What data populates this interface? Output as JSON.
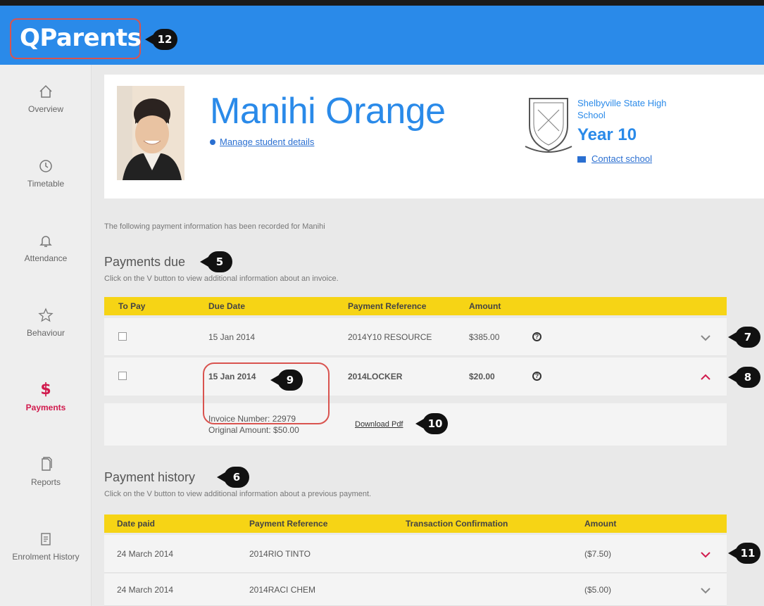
{
  "app": {
    "logo": "QParents"
  },
  "callouts": {
    "logo": "12",
    "payments_due": "5",
    "payment_history": "6",
    "row1_expand": "7",
    "row2_collapse": "8",
    "due_date": "9",
    "download_pdf": "10",
    "history_expand": "11"
  },
  "sidebar": {
    "items": [
      {
        "label": "Overview",
        "icon": "home-icon"
      },
      {
        "label": "Timetable",
        "icon": "clock-icon"
      },
      {
        "label": "Attendance",
        "icon": "bell-icon"
      },
      {
        "label": "Behaviour",
        "icon": "star-icon"
      },
      {
        "label": "Payments",
        "icon": "dollar-icon",
        "active": true
      },
      {
        "label": "Reports",
        "icon": "report-icon"
      },
      {
        "label": "Enrolment History",
        "icon": "document-icon"
      }
    ]
  },
  "profile": {
    "name": "Manihi Orange",
    "manage_link": "Manage student details",
    "school": "Shelbyville State High School",
    "year": "Year 10",
    "contact_link": "Contact school"
  },
  "intro": "The following payment information has been recorded for Manihi",
  "payments_due": {
    "title": "Payments due",
    "subtitle": "Click on the V button to view additional information about an invoice.",
    "columns": [
      "To Pay",
      "Due Date",
      "Payment Reference",
      "Amount"
    ],
    "rows": [
      {
        "due_date": "15 Jan 2014",
        "reference": "2014Y10 RESOURCE",
        "amount": "$385.00"
      },
      {
        "due_date": "15 Jan 2014",
        "reference": "2014LOCKER",
        "amount": "$20.00"
      }
    ],
    "expanded": {
      "invoice_number": "Invoice Number: 22979",
      "original_amount": "Original Amount: $50.00",
      "download": "Download Pdf"
    }
  },
  "payment_history": {
    "title": "Payment history",
    "subtitle": "Click on the V button to view additional information about a previous payment.",
    "columns": [
      "Date paid",
      "Payment Reference",
      "Transaction Confirmation",
      "Amount"
    ],
    "rows": [
      {
        "date": "24 March 2014",
        "reference": "2014RIO TINTO",
        "amount": "($7.50)"
      },
      {
        "date": "24 March 2014",
        "reference": "2014RACI CHEM",
        "amount": "($5.00)"
      }
    ]
  },
  "colors": {
    "brand_blue": "#2a8ae9",
    "header_yellow": "#f6d415",
    "active_pink": "#d11a4d",
    "highlight_red": "#d9534f"
  }
}
